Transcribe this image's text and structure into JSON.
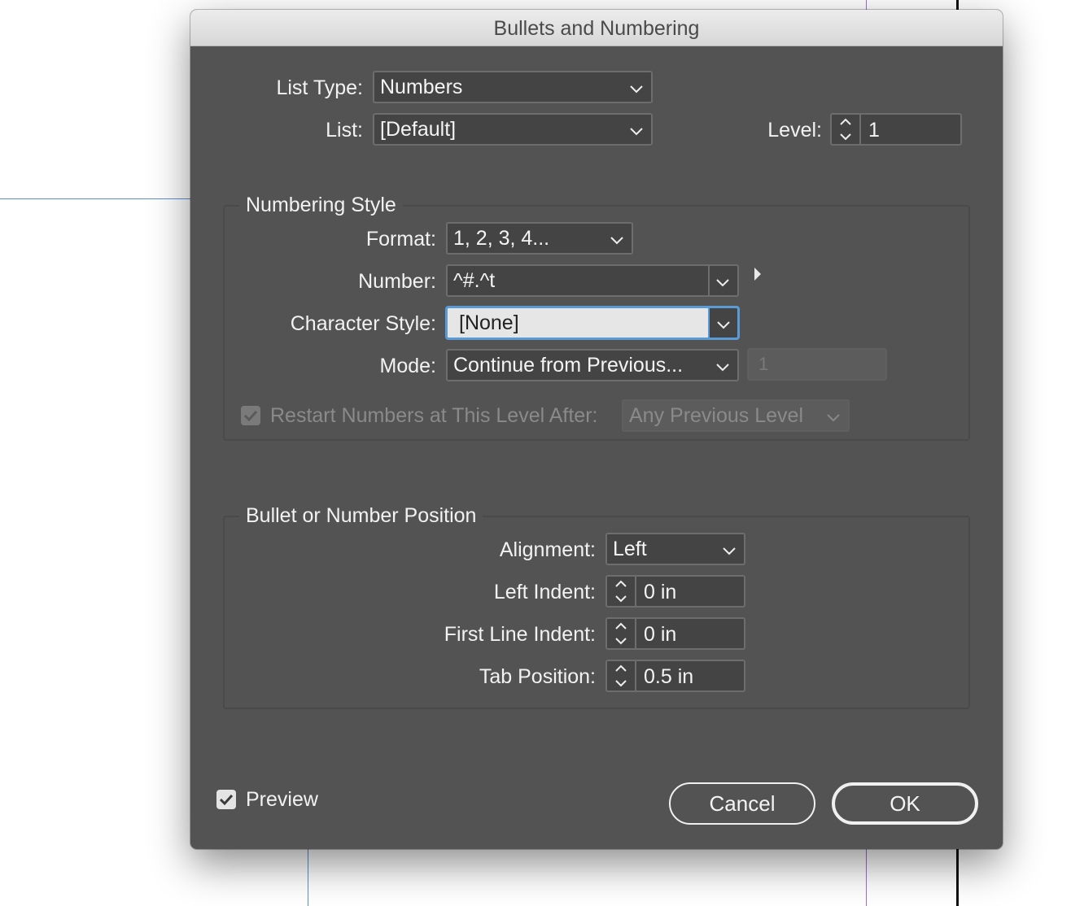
{
  "dialog": {
    "title": "Bullets and Numbering"
  },
  "list_type": {
    "label": "List Type:",
    "value": "Numbers"
  },
  "list": {
    "label": "List:",
    "value": "[Default]"
  },
  "level": {
    "label": "Level:",
    "value": "1"
  },
  "numbering_style": {
    "title": "Numbering Style",
    "format": {
      "label": "Format:",
      "value": "1, 2, 3, 4..."
    },
    "number": {
      "label": "Number:",
      "value": "^#.^t"
    },
    "character_style": {
      "label": "Character Style:",
      "value": "[None]"
    },
    "mode": {
      "label": "Mode:",
      "value": "Continue from Previous...",
      "start_value": "1"
    },
    "restart": {
      "label": "Restart Numbers at This Level After:",
      "value": "Any Previous Level",
      "checked": true
    }
  },
  "position": {
    "title": "Bullet or Number Position",
    "alignment": {
      "label": "Alignment:",
      "value": "Left"
    },
    "left_indent": {
      "label": "Left Indent:",
      "value": "0 in"
    },
    "first_line_indent": {
      "label": "First Line Indent:",
      "value": "0 in"
    },
    "tab_position": {
      "label": "Tab Position:",
      "value": "0.5 in"
    }
  },
  "preview": {
    "label": "Preview",
    "checked": true
  },
  "buttons": {
    "cancel": "Cancel",
    "ok": "OK"
  },
  "colors": {
    "dialog_bg": "#535353",
    "field_bg": "#444444",
    "focus_ring": "#5b9bd5",
    "active_field_bg": "#e6e6e6"
  },
  "icons": {
    "dropdown": "chevron-down-icon",
    "stepper": "stepper-arrows-icon",
    "disclosure": "triangle-right-icon",
    "check": "checkmark-icon"
  }
}
